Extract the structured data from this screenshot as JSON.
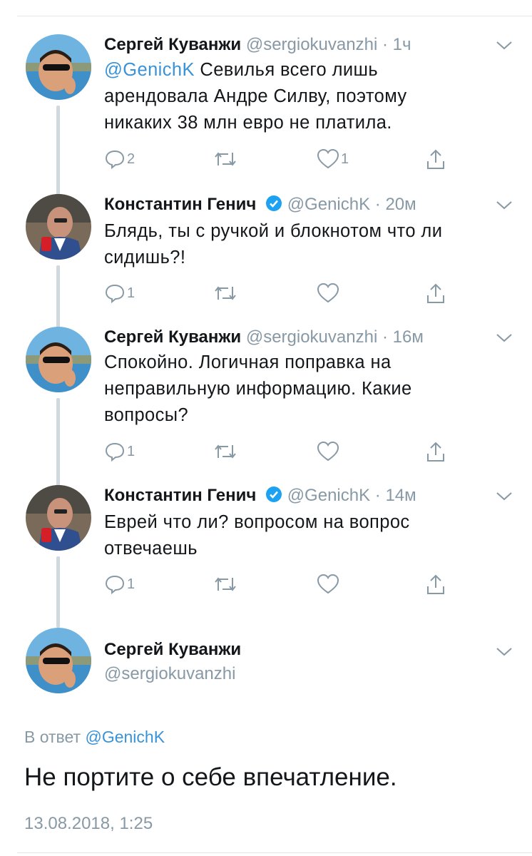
{
  "tweets": [
    {
      "name": "Сергей Куванжи",
      "verified": false,
      "handle": "@sergiokuvanzhi",
      "sep": "·",
      "time": "1ч",
      "mention": "@GenichK",
      "text": " Севилья всего лишь арендовала Андре Силву, поэтому никаких 38 млн евро не платила.",
      "replies": "2",
      "retweets": "",
      "likes": "1"
    },
    {
      "name": "Константин Генич",
      "verified": true,
      "handle": "@GenichK",
      "sep": "·",
      "time": "20м",
      "mention": "",
      "text": "Блядь, ты с ручкой и блокнотом что ли сидишь?!",
      "replies": "1",
      "retweets": "",
      "likes": ""
    },
    {
      "name": "Сергей Куванжи",
      "verified": false,
      "handle": "@sergiokuvanzhi",
      "sep": "·",
      "time": "16м",
      "mention": "",
      "text": "Спокойно. Логичная поправка на неправильную информацию. Какие вопросы?",
      "replies": "1",
      "retweets": "",
      "likes": ""
    },
    {
      "name": "Константин Генич",
      "verified": true,
      "handle": "@GenichK",
      "sep": "·",
      "time": "14м",
      "mention": "",
      "text": "Еврей что ли? вопросом на вопрос отвечаешь",
      "replies": "1",
      "retweets": "",
      "likes": ""
    }
  ],
  "focus": {
    "name": "Сергей Куванжи",
    "handle": "@sergiokuvanzhi",
    "reply_prefix": "В ответ ",
    "reply_mention": "@GenichK",
    "text": "Не портите о себе впечатление.",
    "timestamp": "13.08.2018, 1:25"
  },
  "icons": {
    "reply": "reply-icon",
    "retweet": "retweet-icon",
    "like": "heart-icon",
    "share": "share-icon",
    "caret": "chevron-down-icon",
    "verified": "verified-badge-icon"
  },
  "colors": {
    "link": "#3a93d6",
    "secondary": "#8899a6",
    "verified": "#1da1f2",
    "thread_line": "#cfd9de"
  }
}
